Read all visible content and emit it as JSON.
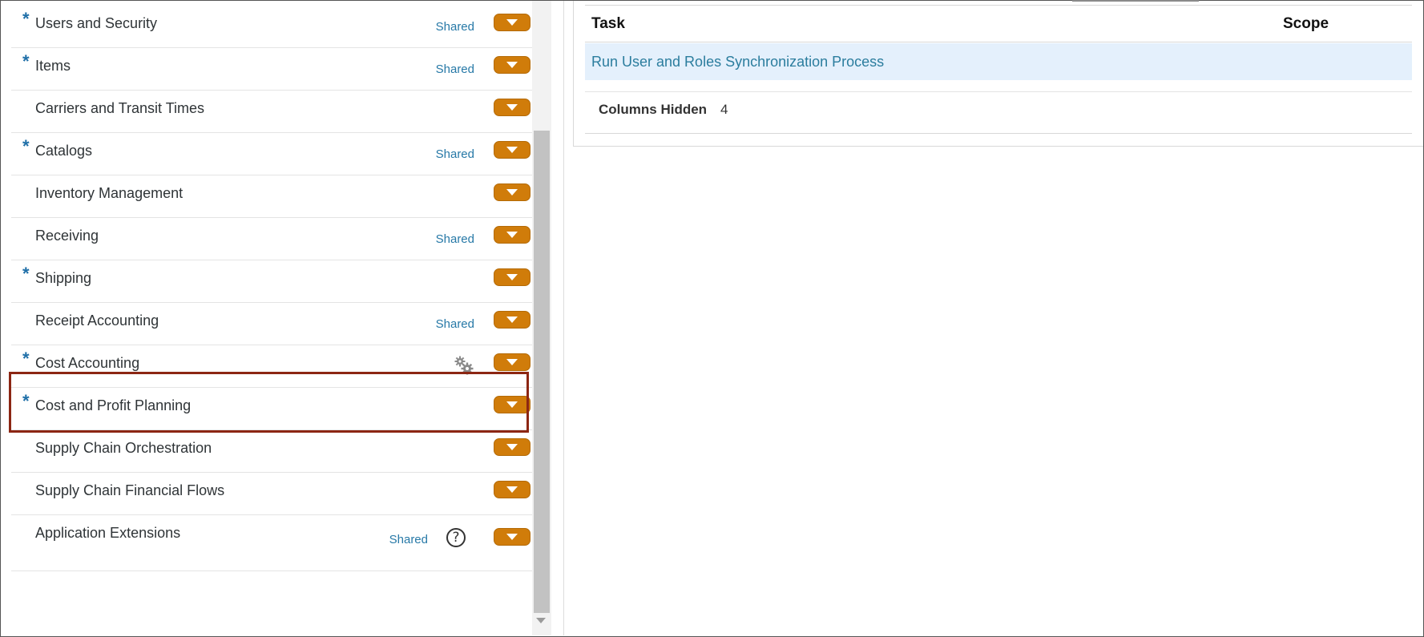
{
  "areas": [
    {
      "label": "Users and Security",
      "required": true,
      "shared": "Shared"
    },
    {
      "label": "Items",
      "required": true,
      "shared": "Shared"
    },
    {
      "label": "Carriers and Transit Times",
      "required": false,
      "shared": ""
    },
    {
      "label": "Catalogs",
      "required": true,
      "shared": "Shared"
    },
    {
      "label": "Inventory Management",
      "required": false,
      "shared": ""
    },
    {
      "label": "Receiving",
      "required": false,
      "shared": "Shared"
    },
    {
      "label": "Shipping",
      "required": true,
      "shared": ""
    },
    {
      "label": "Receipt Accounting",
      "required": false,
      "shared": "Shared"
    },
    {
      "label": "Cost Accounting",
      "required": true,
      "shared": "",
      "icon": "gears-icon"
    },
    {
      "label": "Cost and Profit Planning",
      "required": true,
      "shared": ""
    },
    {
      "label": "Supply Chain Orchestration",
      "required": false,
      "shared": ""
    },
    {
      "label": "Supply Chain Financial Flows",
      "required": false,
      "shared": ""
    },
    {
      "label": "Application Extensions",
      "required": false,
      "shared": "Shared",
      "icon": "help-icon"
    }
  ],
  "required_marker": "*",
  "table": {
    "col_task": "Task",
    "col_scope": "Scope",
    "rows": [
      {
        "task": "Run User and Roles Synchronization Process"
      }
    ],
    "columns_hidden_label": "Columns Hidden",
    "columns_hidden_count": "4"
  },
  "colors": {
    "accent_button": "#d07c0a",
    "link": "#2b7d9e",
    "required_star": "#1f6fa8",
    "highlight": "#8c2613",
    "selected_row": "#e4f0fc"
  }
}
